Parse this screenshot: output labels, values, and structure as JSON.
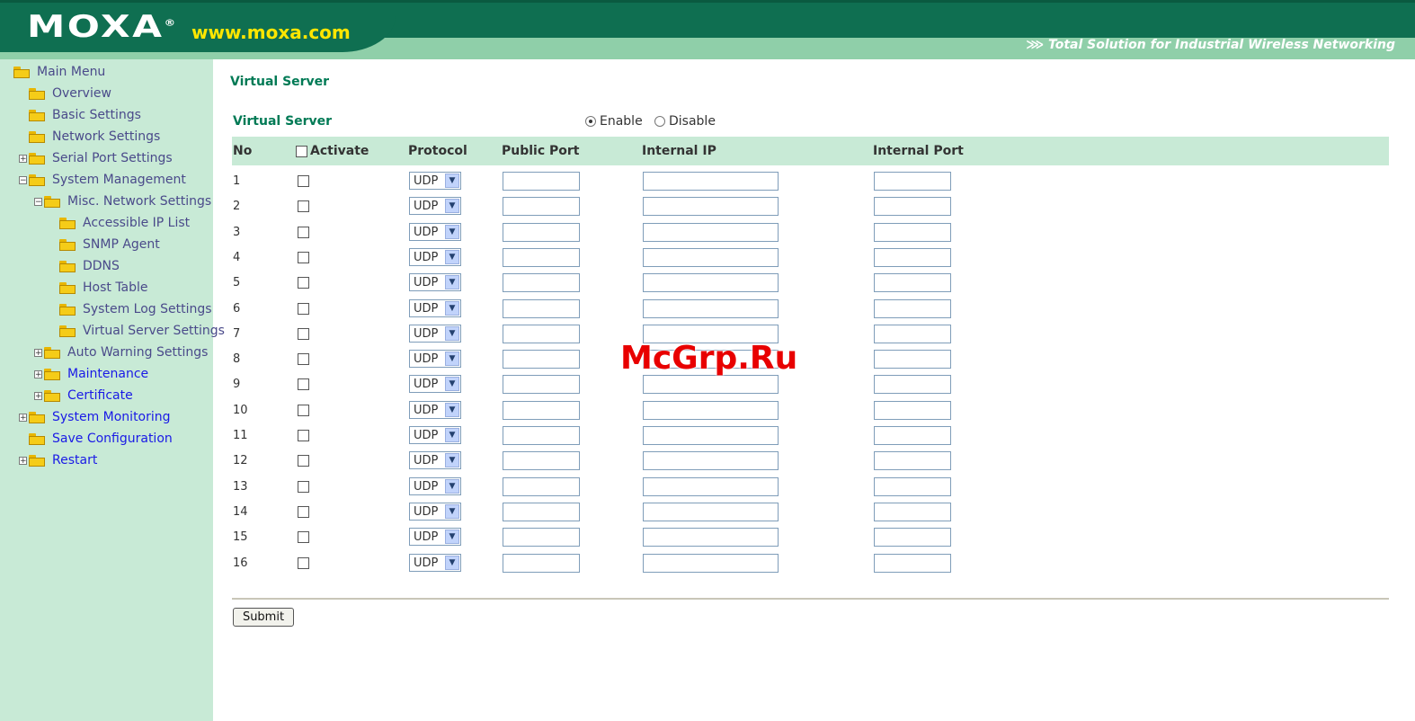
{
  "header": {
    "logo": "MOXA",
    "logo_mark": "®",
    "url": "www.moxa.com",
    "tagline": "⋙ Total Solution for Industrial Wireless Networking"
  },
  "sidebar": {
    "items": [
      {
        "label": "Main Menu",
        "level": 0,
        "expander": "",
        "icon": "open-folder-icon"
      },
      {
        "label": "Overview",
        "level": 1,
        "expander": "",
        "icon": "folder-icon"
      },
      {
        "label": "Basic Settings",
        "level": 1,
        "expander": "",
        "icon": "folder-icon"
      },
      {
        "label": "Network Settings",
        "level": 1,
        "expander": "",
        "icon": "folder-icon"
      },
      {
        "label": "Serial Port Settings",
        "level": 1,
        "expander": "+",
        "icon": "folder-icon"
      },
      {
        "label": "System Management",
        "level": 1,
        "expander": "−",
        "icon": "open-folder-icon"
      },
      {
        "label": "Misc. Network Settings",
        "level": 2,
        "expander": "−",
        "icon": "open-folder-icon"
      },
      {
        "label": "Accessible IP List",
        "level": 3,
        "expander": "",
        "icon": "folder-icon"
      },
      {
        "label": "SNMP Agent",
        "level": 3,
        "expander": "",
        "icon": "folder-icon"
      },
      {
        "label": "DDNS",
        "level": 3,
        "expander": "",
        "icon": "folder-icon"
      },
      {
        "label": "Host Table",
        "level": 3,
        "expander": "",
        "icon": "folder-icon"
      },
      {
        "label": "System Log Settings",
        "level": 3,
        "expander": "",
        "icon": "folder-icon"
      },
      {
        "label": "Virtual Server Settings",
        "level": 3,
        "expander": "",
        "icon": "folder-icon"
      },
      {
        "label": "Auto Warning Settings",
        "level": 2,
        "expander": "+",
        "icon": "folder-icon"
      },
      {
        "label": "Maintenance",
        "level": 2,
        "expander": "+",
        "icon": "folder-icon"
      },
      {
        "label": "Certificate",
        "level": 2,
        "expander": "+",
        "icon": "folder-icon"
      },
      {
        "label": "System Monitoring",
        "level": 1,
        "expander": "+",
        "icon": "folder-icon"
      },
      {
        "label": "Save Configuration",
        "level": 1,
        "expander": "",
        "icon": "folder-icon"
      },
      {
        "label": "Restart",
        "level": 1,
        "expander": "+",
        "icon": "folder-icon"
      }
    ]
  },
  "main": {
    "page_title": "Virtual Server",
    "vs_label": "Virtual Server",
    "enable_label": "Enable",
    "disable_label": "Disable",
    "enabled": true,
    "columns": {
      "no": "No",
      "activate": "Activate",
      "protocol": "Protocol",
      "public_port": "Public Port",
      "internal_ip": "Internal IP",
      "internal_port": "Internal Port"
    },
    "rows": [
      {
        "no": "1",
        "protocol": "UDP"
      },
      {
        "no": "2",
        "protocol": "UDP"
      },
      {
        "no": "3",
        "protocol": "UDP"
      },
      {
        "no": "4",
        "protocol": "UDP"
      },
      {
        "no": "5",
        "protocol": "UDP"
      },
      {
        "no": "6",
        "protocol": "UDP"
      },
      {
        "no": "7",
        "protocol": "UDP"
      },
      {
        "no": "8",
        "protocol": "UDP"
      },
      {
        "no": "9",
        "protocol": "UDP"
      },
      {
        "no": "10",
        "protocol": "UDP"
      },
      {
        "no": "11",
        "protocol": "UDP"
      },
      {
        "no": "12",
        "protocol": "UDP"
      },
      {
        "no": "13",
        "protocol": "UDP"
      },
      {
        "no": "14",
        "protocol": "UDP"
      },
      {
        "no": "15",
        "protocol": "UDP"
      },
      {
        "no": "16",
        "protocol": "UDP"
      }
    ],
    "submit_label": "Submit"
  },
  "watermark": "McGrp.Ru"
}
